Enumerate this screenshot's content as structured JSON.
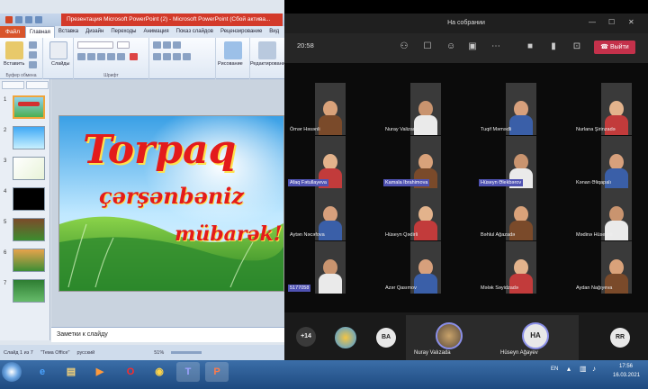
{
  "powerpoint": {
    "title": "Презентация Microsoft PowerPoint (2) - Microsoft PowerPoint (Сбой актива...",
    "file_tab": "Файл",
    "tabs": [
      "Главная",
      "Вставка",
      "Дизайн",
      "Переходы",
      "Анимация",
      "Показ слайдов",
      "Рецензирование",
      "Вид"
    ],
    "ribbon": {
      "paste": "Вставить",
      "clipboard": "Буфер обмена",
      "slides": "Слайды",
      "font": "Шрифт",
      "drawing": "Рисование",
      "editing": "Редактирование"
    },
    "slide_numbers": [
      "1",
      "2",
      "3",
      "4",
      "5",
      "6",
      "7"
    ],
    "slide": {
      "line1": "Torpaq",
      "line2": "çərşənbəniz",
      "line3": "mübarək!"
    },
    "notes_placeholder": "Заметки к слайду",
    "status": {
      "slide_info": "Слайд 1 из 7",
      "theme": "\"Тема Office\"",
      "language": "русский",
      "zoom": "51%"
    }
  },
  "teams": {
    "window_title": "На собрании",
    "timer": "20:58",
    "leave_label": "Выйти",
    "participants": [
      {
        "name": "Ömər Həsənli",
        "hl": false
      },
      {
        "name": "Nuray Valizada",
        "hl": false
      },
      {
        "name": "Tuqif Məmədli",
        "hl": false
      },
      {
        "name": "Nurlana Şirinzadə",
        "hl": false
      },
      {
        "name": "Afaq Fətullayeva",
        "hl": true
      },
      {
        "name": "Kamala Ibrahimova",
        "hl": true
      },
      {
        "name": "Hüseyn Əlekbərov",
        "hl": true
      },
      {
        "name": "Kənan Əliqapalı",
        "hl": false
      },
      {
        "name": "Aytən Nəcəfova",
        "hl": false
      },
      {
        "name": "Hüseyn Qədirli",
        "hl": false
      },
      {
        "name": "Bəhlul Ağazadə",
        "hl": false
      },
      {
        "name": "Mədinə Hüseynli",
        "hl": false
      },
      {
        "name": "5177058",
        "hl": true
      },
      {
        "name": "Azər Qasımov",
        "hl": false
      },
      {
        "name": "Mələk Səyidzadə",
        "hl": false
      },
      {
        "name": "Aydan Nağıyeva",
        "hl": false
      }
    ],
    "overflow_count": "+14",
    "strip": {
      "avatar_ba": "BA",
      "name1": "Nuray Valızada",
      "avatar_ha": "HA",
      "name2": "Hüseyn Ağayev",
      "avatar_rr": "RR"
    }
  },
  "taskbar": {
    "lang": "EN",
    "time": "17:56",
    "date": "16.03.2021"
  },
  "colors": {
    "leave": "#c4314b",
    "name_highlight": "#4f52b2",
    "file_tab": "#d8542b",
    "ppt_title_active": "#d33a2a"
  }
}
